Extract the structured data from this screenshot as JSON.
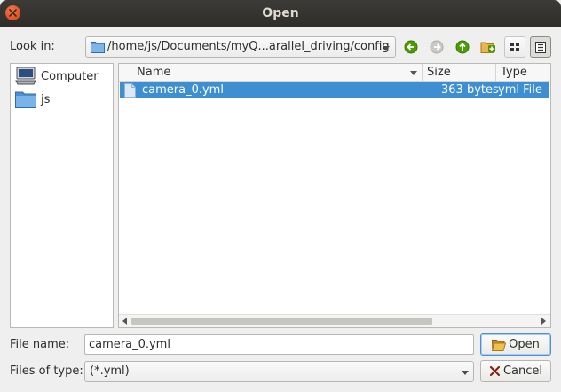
{
  "window": {
    "title": "Open"
  },
  "look_in": {
    "label": "Look in:",
    "path": "/home/js/Documents/myQ...arallel_driving/config"
  },
  "toolbar": {
    "icons": [
      "back-icon",
      "forward-icon",
      "parent-dir-icon",
      "new-folder-icon",
      "list-view-icon",
      "detail-view-icon"
    ]
  },
  "sidebar": {
    "items": [
      {
        "label": "Computer",
        "icon": "computer-icon"
      },
      {
        "label": "js",
        "icon": "folder-icon"
      }
    ]
  },
  "file_list": {
    "columns": [
      "Name",
      "Size",
      "Type"
    ],
    "rows": [
      {
        "name": "camera_0.yml",
        "size": "363 bytes",
        "type": "yml File",
        "selected": true
      }
    ]
  },
  "file_name": {
    "label": "File name:",
    "value": "camera_0.yml"
  },
  "file_type": {
    "label": "Files of type:",
    "value": "(*.yml)"
  },
  "buttons": {
    "open": "Open",
    "cancel": "Cancel"
  },
  "colors": {
    "selection": "#3d8fd1",
    "titlebar": "#3c3b37",
    "close": "#e0501f"
  }
}
